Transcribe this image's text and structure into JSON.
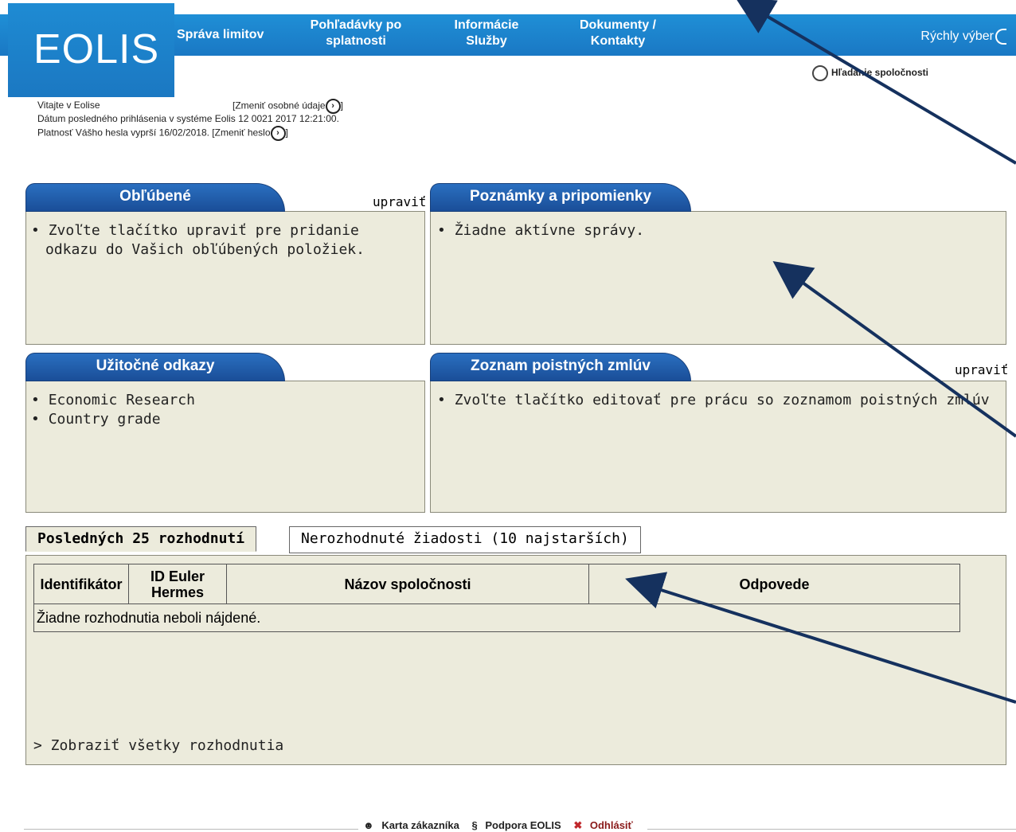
{
  "logo": "EOLIS",
  "nav": {
    "items": [
      {
        "label": "Správa limitov"
      },
      {
        "label": "Pohľadávky po\nsplatnosti"
      },
      {
        "label": "Informácie\nSlužby"
      },
      {
        "label": "Dokumenty /\nKontakty"
      }
    ],
    "quick_select": "Rýchly výber"
  },
  "search_company": "Hľadanie spoločnosti",
  "welcome": {
    "greeting": "Vitajte v Eolise",
    "change_personal": "[Zmeniť osobné údaje",
    "change_personal_end": "]",
    "last_login": "Dátum posledného prihlásenia v systéme Eolis 12 0021 2017 12:21:00.",
    "password_expiry": "Platnosť Vášho hesla vyprší 16/02/2018. [Zmeniť heslo",
    "password_end": "]"
  },
  "favorites": {
    "title": "Obľúbené",
    "edit": "upraviť",
    "items": [
      "Zvoľte tlačítko upraviť pre pridanie odkazu do Vašich obľúbených položiek."
    ]
  },
  "notes": {
    "title": "Poznámky a pripomienky",
    "items": [
      "Žiadne aktívne správy."
    ]
  },
  "useful_links": {
    "title": "Užitočné odkazy",
    "items": [
      "Economic Research",
      "Country grade"
    ]
  },
  "policies": {
    "title": "Zoznam poistných zmlúv",
    "edit": "upraviť",
    "items": [
      "Zvoľte tlačítko editovať pre prácu so zoznamom poistných zmlúv"
    ]
  },
  "decisions": {
    "tabs": [
      "Posledných 25 rozhodnutí",
      "Nerozhodnuté žiadosti (10 najstarších)"
    ],
    "columns": [
      "Identifikátor",
      "ID Euler Hermes",
      "Názov spoločnosti",
      "Odpovede"
    ],
    "empty": "Žiadne rozhodnutia neboli nájdené.",
    "show_all": "> Zobraziť všetky rozhodnutia"
  },
  "footer": {
    "customer_card": "Karta zákazníka",
    "support": "Podpora EOLIS",
    "logout": "Odhlásiť"
  },
  "colors": {
    "nav": "#1a78c4",
    "tab": "#1a4e98",
    "panel_bg": "#ecebdc",
    "annotation_arrow": "#15315e",
    "logout_icon": "#c0282c"
  }
}
